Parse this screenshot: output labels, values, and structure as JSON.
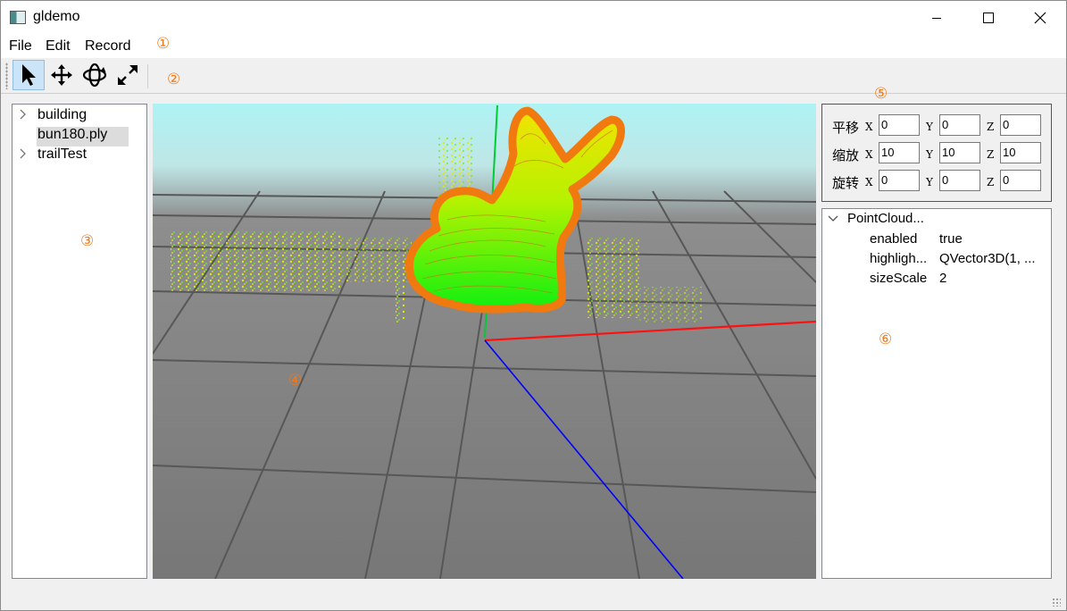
{
  "window": {
    "title": "gldemo",
    "controls": [
      "minimize",
      "maximize",
      "close"
    ]
  },
  "menu": {
    "items": [
      "File",
      "Edit",
      "Record"
    ]
  },
  "toolbar": {
    "tools": [
      {
        "name": "select",
        "icon": "arrow-pointer-icon",
        "active": true
      },
      {
        "name": "move",
        "icon": "move-arrows-icon",
        "active": false
      },
      {
        "name": "rotate",
        "icon": "rotate-orbit-icon",
        "active": false
      },
      {
        "name": "scale",
        "icon": "expand-icon",
        "active": false
      }
    ]
  },
  "markers": [
    "①",
    "②",
    "③",
    "④",
    "⑤",
    "⑥"
  ],
  "tree": {
    "items": [
      {
        "label": "building",
        "expandable": true,
        "selected": false
      },
      {
        "label": "bun180.ply",
        "expandable": false,
        "selected": true
      },
      {
        "label": "trailTest",
        "expandable": true,
        "selected": false
      }
    ]
  },
  "transform": {
    "rows": [
      {
        "label": "平移",
        "x": "0",
        "y": "0",
        "z": "0"
      },
      {
        "label": "缩放",
        "x": "10",
        "y": "10",
        "z": "10"
      },
      {
        "label": "旋转",
        "x": "0",
        "y": "0",
        "z": "0"
      }
    ],
    "axes": [
      "X",
      "Y",
      "Z"
    ]
  },
  "properties": {
    "root": "PointCloud...",
    "rows": [
      {
        "name": "enabled",
        "value": "true"
      },
      {
        "name": "highligh...",
        "value": "QVector3D(1, ..."
      },
      {
        "name": "sizeScale",
        "value": "2"
      }
    ]
  },
  "colors": {
    "accent_marker": "#f07a1a",
    "viewport_sky": "#aef0f2",
    "viewport_ground": "#7d7d7d",
    "axis_x": "#ff0000",
    "axis_y": "#00cc00",
    "axis_z": "#0000ff",
    "bunny_outline": "#f07a10"
  }
}
